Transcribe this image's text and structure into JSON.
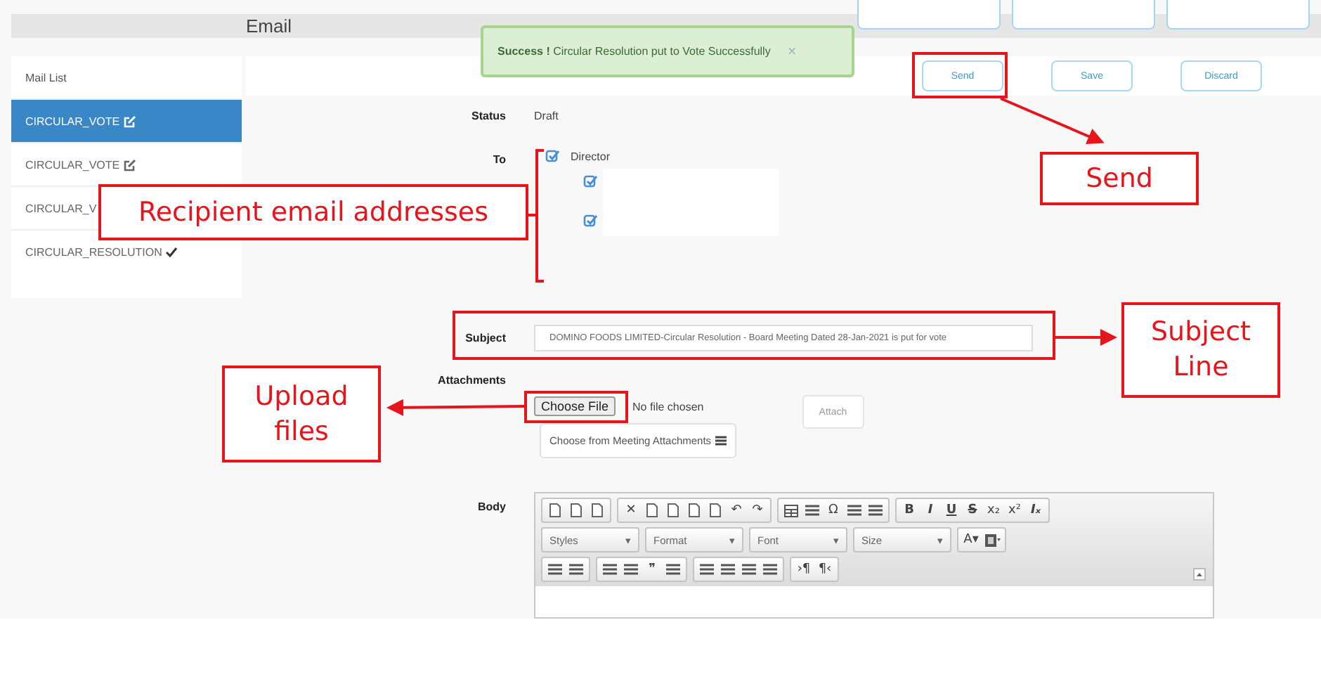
{
  "header": {
    "title": "Email"
  },
  "toast": {
    "message": "**Success !** Circular Resolution put to Vote Successfully",
    "close": "×"
  },
  "sidebar": {
    "title": "Mail List",
    "items": [
      {
        "label": "CIRCULAR_VOTE",
        "selected": true,
        "kind": "edit"
      },
      {
        "label": "CIRCULAR_VOTE",
        "selected": false,
        "kind": "edit"
      },
      {
        "label": "CIRCULAR_V",
        "selected": false,
        "kind": "plain"
      },
      {
        "label": "CIRCULAR_RESOLUTION",
        "selected": false,
        "kind": "done"
      }
    ]
  },
  "actions": [
    "Send",
    "Save",
    "Discard"
  ],
  "form": {
    "status_label": "Status",
    "status": "Draft",
    "to_label": "To",
    "recipients": [
      {
        "label": "Director",
        "checked": true,
        "children": [
          {
            "checked": true
          },
          {
            "checked": true
          }
        ]
      }
    ],
    "subject_label": "Subject",
    "subject": "DOMINO FOODS LIMITED-Circular Resolution - Board Meeting Dated 28-Jan-2021 is put for vote",
    "attachments_label": "Attachments",
    "choose_file": "Choose File",
    "no_file": "No file chosen",
    "attach": "Attach",
    "meeting_attachments": "Choose from Meeting Attachments",
    "body_label": "Body"
  },
  "toolbar": [
    [
      [
        {
          "kind": "doc"
        },
        {
          "kind": "doc"
        },
        {
          "kind": "doc"
        }
      ],
      [
        {
          "kind": "glyph",
          "text": "✕"
        },
        {
          "kind": "doc"
        },
        {
          "kind": "doc"
        },
        {
          "kind": "doc"
        },
        {
          "kind": "doc"
        },
        {
          "kind": "glyph",
          "text": "↶"
        },
        {
          "kind": "glyph",
          "text": "↷"
        }
      ],
      [
        {
          "kind": "table"
        },
        {
          "kind": "lines"
        },
        {
          "kind": "glyph",
          "text": "Ω"
        },
        {
          "kind": "lines"
        },
        {
          "kind": "lines"
        }
      ],
      [
        {
          "kind": "bold",
          "text": "B"
        },
        {
          "kind": "italic",
          "text": "I"
        },
        {
          "kind": "underline",
          "text": "U"
        },
        {
          "kind": "strike",
          "text": "S"
        },
        {
          "kind": "glyph",
          "text": "x₂"
        },
        {
          "kind": "glyph",
          "text": "x²"
        },
        {
          "kind": "italic",
          "text": "Iₓ"
        }
      ]
    ],
    [
      [
        {
          "kind": "dropdown",
          "text": "Styles",
          "caret": "▾"
        }
      ],
      [
        {
          "kind": "dropdown",
          "text": "Format",
          "caret": "▾"
        }
      ],
      [
        {
          "kind": "dropdown",
          "text": "Font",
          "caret": "▾"
        }
      ],
      [
        {
          "kind": "dropdown",
          "text": "Size",
          "caret": "▾"
        }
      ],
      [
        {
          "kind": "glyph",
          "text": "A▾"
        },
        {
          "kind": "swatch"
        }
      ]
    ],
    [
      [
        {
          "kind": "lines"
        },
        {
          "kind": "lines"
        }
      ],
      [
        {
          "kind": "lines"
        },
        {
          "kind": "lines"
        },
        {
          "kind": "glyph",
          "text": "❞"
        },
        {
          "kind": "lines"
        }
      ],
      [
        {
          "kind": "lines"
        },
        {
          "kind": "lines"
        },
        {
          "kind": "lines"
        },
        {
          "kind": "lines"
        }
      ],
      [
        {
          "kind": "glyph",
          "text": "›¶"
        },
        {
          "kind": "glyph",
          "text": "¶‹"
        }
      ]
    ]
  ],
  "callouts": [
    {
      "text": "Send"
    },
    {
      "text": "Recipient email addresses"
    },
    {
      "text": "Subject Line"
    },
    {
      "text": "Upload files"
    }
  ]
}
